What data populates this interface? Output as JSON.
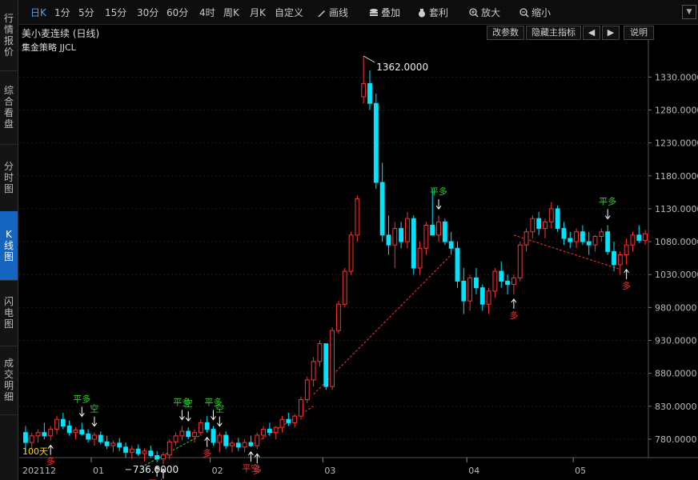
{
  "sidebar": {
    "tabs": [
      {
        "label": "行情报价",
        "active": false
      },
      {
        "label": "综合看盘",
        "active": false
      },
      {
        "label": "分时图",
        "active": false
      },
      {
        "label": "K线图",
        "active": true
      },
      {
        "label": "闪电图",
        "active": false
      },
      {
        "label": "成交明细",
        "active": false
      }
    ]
  },
  "toolbar": {
    "periods": [
      "日K",
      "1分",
      "5分",
      "15分",
      "30分",
      "60分",
      "4时",
      "周K",
      "月K",
      "自定义"
    ],
    "active_period": "日K",
    "draw_label": "画线",
    "overlay_label": "叠加",
    "arbitrage_label": "套利",
    "zoom_in_label": "放大",
    "zoom_out_label": "缩小"
  },
  "subbar": {
    "title": "美小麦连续 (日线)",
    "modify_params": "改参数",
    "hide_indicator": "隐藏主指标",
    "explain": "说明"
  },
  "strategy_label": "集金策略 JJCL",
  "colors": {
    "up": "#ff3232",
    "down": "#00e5ff",
    "signal_green": "#33cc33",
    "signal_red": "#ff3232",
    "axis_text": "#bbbbbb",
    "accent": "#1565c0"
  },
  "chart_data": {
    "type": "candlestick",
    "y_ticks": [
      "1330.0000",
      "1280.0000",
      "1230.0000",
      "1180.0000",
      "1130.0000",
      "1080.0000",
      "1030.0000",
      "980.0000",
      "930.0000",
      "880.0000",
      "830.0000",
      "780.0000"
    ],
    "ylim": [
      752,
      1362
    ],
    "x_ticks": [
      "202112",
      "01",
      "02",
      "03",
      "04",
      "05"
    ],
    "max_label": "1362.0000",
    "min_label": "736.0000",
    "bars_label": "100天",
    "candles": [
      [
        790,
        800,
        760,
        775
      ],
      [
        775,
        790,
        765,
        785
      ],
      [
        785,
        795,
        775,
        790
      ],
      [
        790,
        805,
        780,
        785
      ],
      [
        785,
        800,
        778,
        795
      ],
      [
        795,
        815,
        788,
        810
      ],
      [
        810,
        820,
        795,
        800
      ],
      [
        800,
        808,
        785,
        790
      ],
      [
        790,
        798,
        780,
        794
      ],
      [
        794,
        805,
        785,
        788
      ],
      [
        788,
        795,
        775,
        780
      ],
      [
        780,
        790,
        770,
        786
      ],
      [
        786,
        792,
        772,
        776
      ],
      [
        776,
        785,
        765,
        770
      ],
      [
        770,
        778,
        760,
        774
      ],
      [
        774,
        782,
        762,
        768
      ],
      [
        768,
        775,
        752,
        760
      ],
      [
        760,
        770,
        750,
        765
      ],
      [
        765,
        772,
        755,
        758
      ],
      [
        758,
        766,
        746,
        762
      ],
      [
        762,
        770,
        752,
        755
      ],
      [
        755,
        762,
        745,
        750
      ],
      [
        750,
        760,
        742,
        756
      ],
      [
        756,
        780,
        750,
        776
      ],
      [
        776,
        790,
        770,
        785
      ],
      [
        785,
        800,
        778,
        792
      ],
      [
        792,
        798,
        780,
        784
      ],
      [
        784,
        795,
        775,
        790
      ],
      [
        790,
        810,
        785,
        805
      ],
      [
        805,
        815,
        790,
        795
      ],
      [
        795,
        800,
        770,
        775
      ],
      [
        775,
        790,
        760,
        786
      ],
      [
        786,
        792,
        765,
        770
      ],
      [
        770,
        778,
        760,
        774
      ],
      [
        774,
        782,
        762,
        768
      ],
      [
        768,
        780,
        760,
        775
      ],
      [
        775,
        785,
        768,
        770
      ],
      [
        770,
        790,
        765,
        786
      ],
      [
        786,
        800,
        780,
        795
      ],
      [
        795,
        805,
        785,
        790
      ],
      [
        790,
        800,
        780,
        798
      ],
      [
        798,
        815,
        790,
        810
      ],
      [
        810,
        820,
        800,
        805
      ],
      [
        805,
        818,
        798,
        815
      ],
      [
        815,
        845,
        810,
        840
      ],
      [
        840,
        875,
        835,
        870
      ],
      [
        870,
        905,
        860,
        898
      ],
      [
        898,
        930,
        890,
        925
      ],
      [
        925,
        920,
        855,
        860
      ],
      [
        860,
        950,
        855,
        945
      ],
      [
        945,
        990,
        940,
        985
      ],
      [
        985,
        1040,
        980,
        1035
      ],
      [
        1035,
        1095,
        1030,
        1090
      ],
      [
        1090,
        1150,
        1080,
        1145
      ],
      [
        1300,
        1362,
        1290,
        1320
      ],
      [
        1320,
        1340,
        1280,
        1290
      ],
      [
        1290,
        1305,
        1160,
        1170
      ],
      [
        1170,
        1200,
        1080,
        1090
      ],
      [
        1090,
        1120,
        1060,
        1075
      ],
      [
        1075,
        1110,
        1040,
        1100
      ],
      [
        1100,
        1110,
        1070,
        1080
      ],
      [
        1080,
        1125,
        1070,
        1115
      ],
      [
        1115,
        1120,
        1030,
        1040
      ],
      [
        1040,
        1080,
        1030,
        1070
      ],
      [
        1070,
        1110,
        1060,
        1105
      ],
      [
        1105,
        1160,
        1090,
        1090
      ],
      [
        1090,
        1120,
        1080,
        1110
      ],
      [
        1110,
        1115,
        1075,
        1080
      ],
      [
        1080,
        1095,
        1060,
        1070
      ],
      [
        1070,
        1080,
        1010,
        1020
      ],
      [
        1020,
        1040,
        970,
        990
      ],
      [
        990,
        1030,
        975,
        1025
      ],
      [
        1025,
        1040,
        1000,
        1010
      ],
      [
        1010,
        1015,
        975,
        985
      ],
      [
        985,
        1010,
        970,
        1005
      ],
      [
        1005,
        1040,
        995,
        1035
      ],
      [
        1035,
        1050,
        1010,
        1020
      ],
      [
        1020,
        1030,
        1000,
        1015
      ],
      [
        1015,
        1030,
        1000,
        1025
      ],
      [
        1025,
        1080,
        1020,
        1075
      ],
      [
        1075,
        1100,
        1065,
        1095
      ],
      [
        1095,
        1120,
        1085,
        1115
      ],
      [
        1115,
        1125,
        1090,
        1100
      ],
      [
        1100,
        1115,
        1085,
        1110
      ],
      [
        1110,
        1140,
        1100,
        1130
      ],
      [
        1130,
        1135,
        1095,
        1100
      ],
      [
        1100,
        1110,
        1075,
        1085
      ],
      [
        1085,
        1095,
        1070,
        1080
      ],
      [
        1080,
        1100,
        1070,
        1095
      ],
      [
        1095,
        1105,
        1075,
        1080
      ],
      [
        1080,
        1095,
        1060,
        1075
      ],
      [
        1075,
        1090,
        1065,
        1088
      ],
      [
        1088,
        1100,
        1080,
        1095
      ],
      [
        1095,
        1105,
        1060,
        1065
      ],
      [
        1065,
        1080,
        1035,
        1045
      ],
      [
        1045,
        1065,
        1030,
        1060
      ],
      [
        1060,
        1085,
        1045,
        1075
      ],
      [
        1075,
        1095,
        1065,
        1090
      ],
      [
        1090,
        1105,
        1078,
        1082
      ],
      [
        1082,
        1098,
        1075,
        1092
      ]
    ],
    "month_starts": [
      0,
      11,
      30,
      48,
      71,
      88
    ],
    "signals": [
      {
        "i": 4,
        "text": "多",
        "type": "buy"
      },
      {
        "i": 9,
        "text": "平多",
        "type": "close"
      },
      {
        "i": 11,
        "text": "空",
        "type": "sell"
      },
      {
        "i": 21,
        "text": "平空",
        "type": "close_short"
      },
      {
        "i": 22,
        "text": "多",
        "type": "buy"
      },
      {
        "i": 25,
        "text": "平多",
        "type": "close"
      },
      {
        "i": 26,
        "text": "空",
        "type": "sell"
      },
      {
        "i": 29,
        "text": "多",
        "type": "buy"
      },
      {
        "i": 30,
        "text": "平多",
        "type": "close"
      },
      {
        "i": 31,
        "text": "空",
        "type": "sell"
      },
      {
        "i": 36,
        "text": "平空",
        "type": "close_short"
      },
      {
        "i": 37,
        "text": "多",
        "type": "buy"
      },
      {
        "i": 66,
        "text": "平多",
        "type": "close"
      },
      {
        "i": 78,
        "text": "多",
        "type": "buy"
      },
      {
        "i": 93,
        "text": "平多",
        "type": "close"
      },
      {
        "i": 96,
        "text": "多",
        "type": "buy"
      }
    ]
  }
}
